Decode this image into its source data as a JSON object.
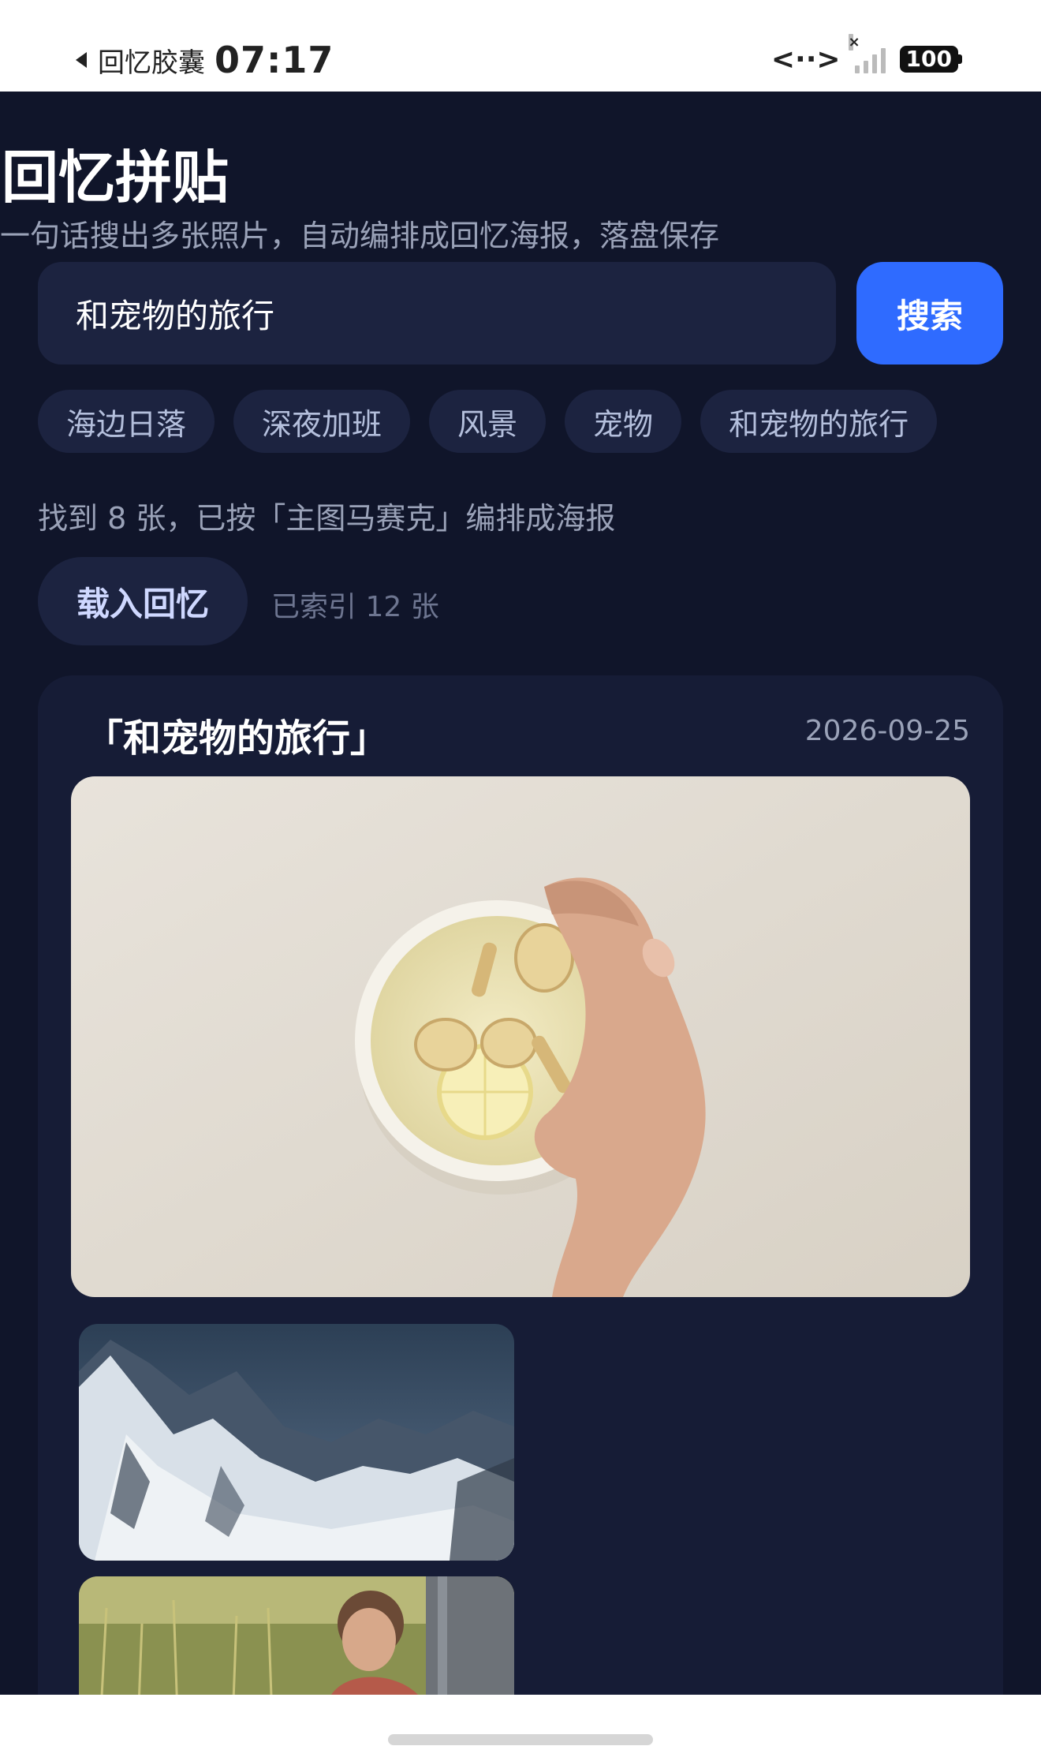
{
  "status_bar": {
    "app_name": "回忆胶囊",
    "time": "07:17",
    "data_indicator": "<··>",
    "battery": "100"
  },
  "header": {
    "title": "回忆拼贴",
    "subtitle": "一句话搜出多张照片，自动编排成回忆海报，落盘保存"
  },
  "search": {
    "value": "和宠物的旅行",
    "button_label": "搜索"
  },
  "chips": [
    "海边日落",
    "深夜加班",
    "风景",
    "宠物",
    "和宠物的旅行"
  ],
  "result_info": "找到 8 张，已按「主图马赛克」编排成海报",
  "load_button_label": "载入回忆",
  "indexed_text": "已索引 12 张",
  "poster": {
    "title": "「和宠物的旅行」",
    "date": "2026-09-25"
  },
  "colors": {
    "background": "#10152a",
    "card": "#161c36",
    "accent": "#2f6bff"
  }
}
